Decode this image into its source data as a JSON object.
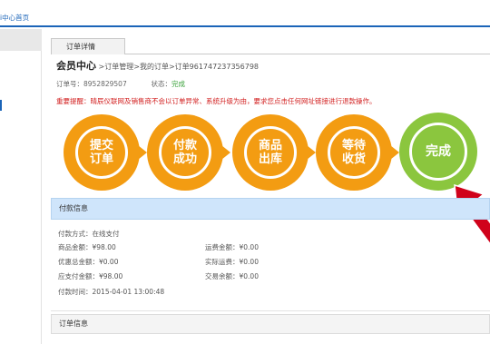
{
  "top_link": "i中心首页",
  "tab": {
    "label": "订单详情"
  },
  "page": {
    "title": "会员中心",
    "breadcrumb": ">订单管理>我的订单>订单961747237356798"
  },
  "meta": {
    "order_no_label": "订单号：",
    "order_no": "8952829507",
    "status_label": "状态：",
    "status": "完成"
  },
  "warning": "重要提醒：晴辰仪联网及销售商不会以订单异常、系统升级为由，要求您点击任何网址链接进行退款操作。",
  "steps": [
    {
      "label": "提交订单"
    },
    {
      "label": "付款成功"
    },
    {
      "label": "商品出库"
    },
    {
      "label": "等待收货"
    },
    {
      "label": "完成"
    }
  ],
  "colors": {
    "step_active": "#f39c12",
    "step_done": "#8bc63e",
    "arrow": "#d0021b",
    "accent": "#1b64b8"
  },
  "payment": {
    "header": "付款信息",
    "method": "付款方式：在线支付",
    "goods_amount": "商品金额：¥98.00",
    "shipping_fee": "运费金额：¥0.00",
    "discount_total": "优惠总金额：¥0.00",
    "actual_shipping": "实际运费：¥0.00",
    "payable": "应支付金额：¥98.00",
    "balance": "交易余额：¥0.00",
    "pay_time": "付款时间：2015-04-01 13:00:48"
  },
  "order_info": {
    "header": "订单信息"
  }
}
